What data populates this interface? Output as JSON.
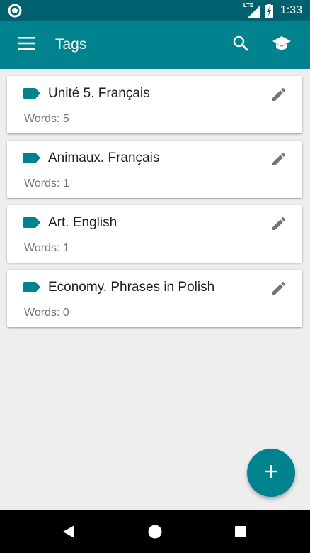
{
  "status_bar": {
    "network_label": "LTE",
    "time": "1:33"
  },
  "app_bar": {
    "title": "Tags",
    "icons": [
      "menu-icon",
      "search-icon",
      "school-icon"
    ]
  },
  "tags": [
    {
      "name": "Unité 5. Français",
      "count_label": "Words: 5"
    },
    {
      "name": "Animaux. Français",
      "count_label": "Words: 1"
    },
    {
      "name": "Art. English",
      "count_label": "Words: 1"
    },
    {
      "name": "Economy. Phrases in Polish",
      "count_label": "Words: 0"
    }
  ],
  "colors": {
    "primary": "#00838f",
    "primary_dark": "#00606d",
    "background": "#eeeeee",
    "card": "#ffffff",
    "edit_icon": "#757575"
  }
}
